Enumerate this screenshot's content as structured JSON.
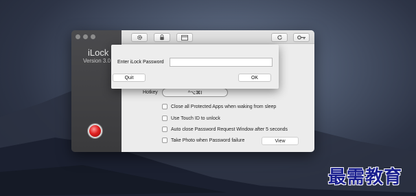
{
  "app": {
    "name": "iLock",
    "version": "Version 3.0"
  },
  "toolbar": {
    "icons": [
      "gear-icon",
      "lock-icon",
      "window-icon",
      "refresh-icon",
      "key-icon"
    ]
  },
  "settings": {
    "hotkey_label": "Hotkey",
    "hotkey_value": "^⌥⌘I",
    "options": [
      {
        "label": "Close all Protected Apps when waking from sleep",
        "checked": false
      },
      {
        "label": "Use Touch ID to unlock",
        "checked": false
      },
      {
        "label": "Auto close Password Request Window after 5 seconds",
        "checked": false
      },
      {
        "label": "Take Photo when Password failure",
        "checked": false
      }
    ],
    "view_button": "View"
  },
  "dialog": {
    "label": "Enter iLock Password",
    "password_value": "",
    "quit_button": "Quit",
    "ok_button": "OK"
  },
  "watermark": "最需教育",
  "colors": {
    "record_button": "#e02020",
    "watermark": "#1a1f8f"
  }
}
